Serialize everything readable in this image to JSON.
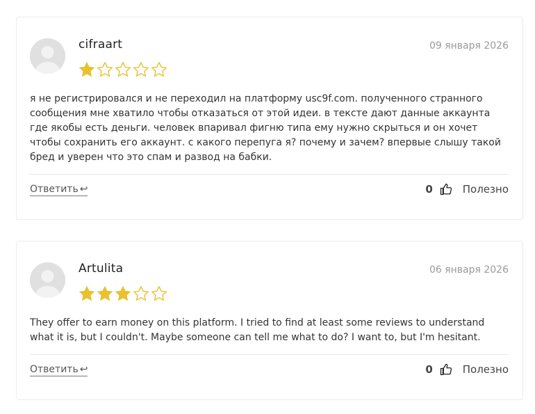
{
  "colors": {
    "star_filled": "#e8c12f",
    "star_empty_stroke": "#e8c12f"
  },
  "reviews": [
    {
      "author": "cifraart",
      "date": "09 января 2026",
      "rating": 1,
      "max_rating": 5,
      "text": "я не регистрировался и не переходил на платформу usc9f.com. полученного странного сообщения мне хватило чтобы отказаться от этой идеи. в тексте дают данные аккаунта где якобы есть деньги. человек впаривал фигню типа ему нужно скрыться и он хочет чтобы сохранить его аккаунт. с какого перепуга я? почему и зачем? впервые слышу такой бред и уверен что это спам и развод на бабки.",
      "reply_label": "Ответить",
      "reply_icon": "↩",
      "helpful_count": "0",
      "helpful_label": "Полезно"
    },
    {
      "author": "Artulita",
      "date": "06 января 2026",
      "rating": 3,
      "max_rating": 5,
      "text": "They offer to earn money on this platform. I tried to find at least some reviews to understand what it is, but I couldn't. Maybe someone can tell me what to do? I want to, but I'm hesitant.",
      "reply_label": "Ответить",
      "reply_icon": "↩",
      "helpful_count": "0",
      "helpful_label": "Полезно"
    }
  ]
}
